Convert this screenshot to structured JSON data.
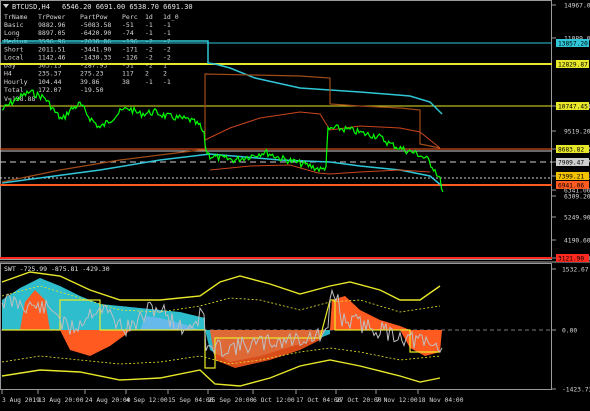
{
  "header": {
    "symbol": "BTCUSD,H4",
    "ohlc": "6546.20 6691.00 6538.70 6691.30"
  },
  "table": {
    "headers": [
      "TrName",
      "TrPower",
      "PartPow",
      "Perc",
      "1d",
      "1d_0"
    ],
    "rows": [
      [
        "Basic",
        "9882.96",
        "-5083.58",
        "-51",
        "-1",
        "-1"
      ],
      [
        "Long",
        "8897.05",
        "-6420.90",
        "-74",
        "-1",
        "-1"
      ],
      [
        "Medium",
        "3596.96",
        "-7038.86",
        "-196",
        "-2",
        "-2"
      ],
      [
        "Short",
        "2011.51",
        "-3441.90",
        "-171",
        "-2",
        "-2"
      ],
      [
        "Local",
        "1142.46",
        "-1430.33",
        "-126",
        "-2",
        "-2"
      ],
      [
        "Day",
        "563.15",
        "-287.93",
        "-51",
        "-2",
        "1"
      ],
      [
        "H4",
        "235.37",
        "275.23",
        "117",
        "2",
        "2"
      ],
      [
        "Hourly",
        "104.44",
        "39.86",
        "38",
        "-1",
        "-1"
      ],
      [
        "Total",
        "172.07",
        "-19.50",
        "",
        "",
        ""
      ]
    ],
    "v_label": "V=138.88"
  },
  "price_axis": {
    "ticks": [
      "14967.00",
      "11089.06",
      "10747.45",
      "9519.20",
      "8683.82",
      "7909.47",
      "7399.21",
      "6341.06",
      "6309.20",
      "5249.90",
      "4190.60",
      "3121.90"
    ],
    "badges": [
      {
        "text": "13857.20",
        "color": "#2fc7d8"
      },
      {
        "text": "12829.87",
        "color": "#e8e82a"
      },
      {
        "text": "10747.45",
        "color": "#e8e82a"
      },
      {
        "text": "8683.82",
        "color": "#e8e82a"
      },
      {
        "text": "7909.47",
        "color": "#cfcfcf"
      },
      {
        "text": "7399.21",
        "color": "#f2c200"
      },
      {
        "text": "6941.06",
        "color": "#ff5a1f"
      },
      {
        "text": "3121.90",
        "color": "#ff2a1f"
      }
    ]
  },
  "indicator": {
    "label": "SWT -725.99 -875.81 -429.30",
    "ticks": [
      "1532.67",
      "0.00",
      "-1423.73"
    ]
  },
  "time_axis": {
    "labels": [
      "3 Aug 2019",
      "13 Aug 20:00",
      "24 Aug 20:00",
      "4 Sep 12:00",
      "15 Sep 04:00",
      "25 Sep 20:00",
      "6 Oct 12:00",
      "17 Oct 04:00",
      "27 Oct 20:00",
      "7 Nov 12:00",
      "18 Nov 04:00"
    ]
  },
  "colors": {
    "background": "#000000",
    "price": "#00ff00",
    "cyan": "#2fc7d8",
    "yellow": "#e8e82a",
    "orange": "#ff5a1f",
    "red": "#ff2a1f",
    "brown": "#a04b17",
    "grid": "#3a3a3a"
  }
}
